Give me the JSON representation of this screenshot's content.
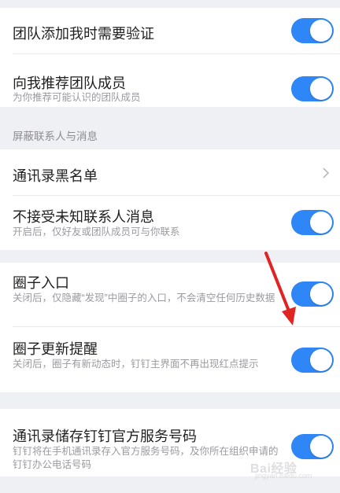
{
  "rows": {
    "team_verify": {
      "title": "团队添加我时需要验证",
      "toggle_on": true
    },
    "recommend": {
      "title": "向我推荐团队成员",
      "subtitle": "为你推荐可能认识的团队成员",
      "toggle_on": true
    },
    "section_block": "屏蔽联系人与消息",
    "blacklist": {
      "title": "通讯录黑名单",
      "chevron_icon": "chevron-right-icon"
    },
    "unknown_msgs": {
      "title": "不接受未知联系人消息",
      "subtitle": "开启后，仅好友或团队成员可与你联系",
      "toggle_on": true
    },
    "circle_entry": {
      "title": "圈子入口",
      "subtitle": "关闭后，仅隐藏“发现”中圈子的入口，不会清空任何历史数据",
      "toggle_on": true
    },
    "circle_update": {
      "title": "圈子更新提醒",
      "subtitle": "关闭后，圈子有新动态时，钉钉主界面不再出现红点提示",
      "toggle_on": true
    },
    "store_numbers": {
      "title": "通讯录储存钉钉官方服务号码",
      "subtitle": "钉钉将在手机通讯录存入官方服务号码，及你所在组织申请的钉钉办公电话号码",
      "toggle_on": true
    }
  },
  "annotation": {
    "arrow_color": "#e02424"
  },
  "watermark": {
    "text": "Bai经验",
    "url": "jingyan.baidu.com"
  },
  "colors": {
    "toggle_on": "#2f86f6",
    "background": "#eff0f4"
  }
}
